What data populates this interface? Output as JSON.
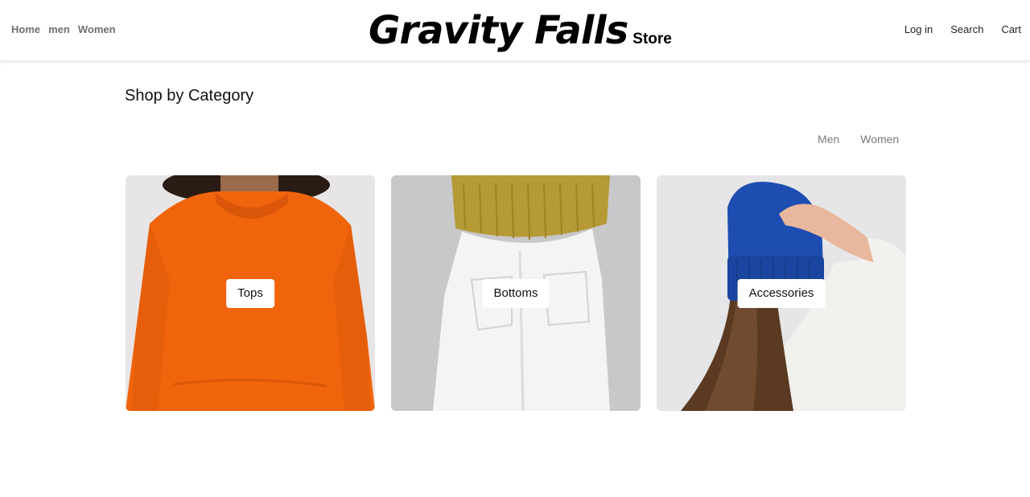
{
  "header": {
    "nav_left": [
      "Home",
      "men",
      "Women"
    ],
    "brand_main": "Gravity Falls",
    "brand_sub": "Store",
    "nav_right": [
      "Log in",
      "Search",
      "Cart"
    ]
  },
  "main": {
    "title": "Shop by Category",
    "filters": [
      "Men",
      "Women"
    ],
    "categories": [
      {
        "label": "Tops",
        "image": "orange-sweater-photo"
      },
      {
        "label": "Bottoms",
        "image": "white-jeans-photo"
      },
      {
        "label": "Accessories",
        "image": "blue-beanie-photo"
      }
    ]
  },
  "colors": {
    "nav_muted": "#6f6f6f",
    "filter_muted": "#7a7a7a",
    "sweater_orange": "#f0640c",
    "beanie_blue": "#1d4db0"
  }
}
